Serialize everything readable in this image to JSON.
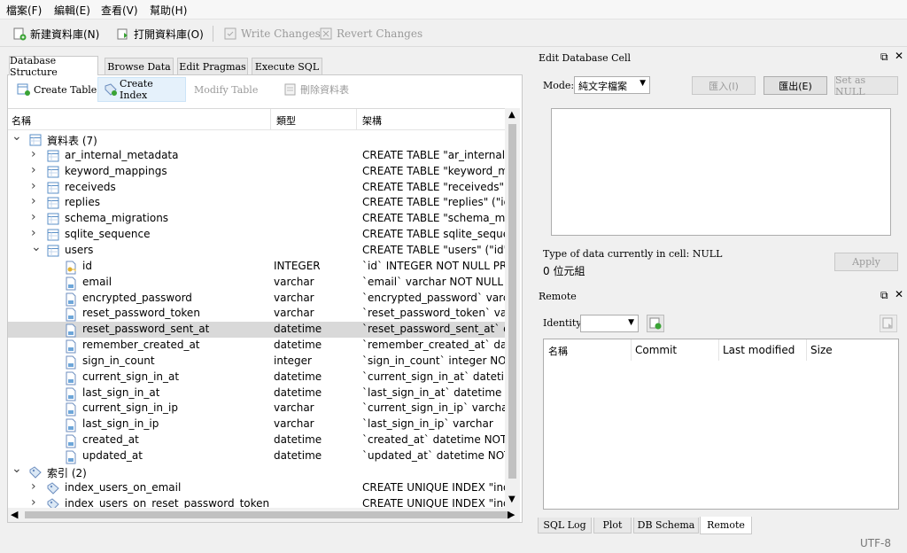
{
  "menu": [
    "檔案(F)",
    "編輯(E)",
    "查看(V)",
    "幫助(H)"
  ],
  "toolbar": {
    "new_db": "新建資料庫(N)",
    "open_db": "打開資料庫(O)",
    "write_changes": "Write Changes",
    "revert_changes": "Revert Changes"
  },
  "tabs": [
    "Database Structure",
    "Browse Data",
    "Edit Pragmas",
    "Execute SQL"
  ],
  "structure_toolbar": {
    "create_table": "Create Table",
    "create_index": "Create Index",
    "modify_table": "Modify Table",
    "delete": "刪除資料表"
  },
  "tree": {
    "headers": {
      "name": "名稱",
      "type": "類型",
      "schema": "架構"
    },
    "tables_group": "資料表 (7)",
    "tables": [
      {
        "name": "ar_internal_metadata",
        "schema": "CREATE TABLE \"ar_internal_m"
      },
      {
        "name": "keyword_mappings",
        "schema": "CREATE TABLE \"keyword_ma"
      },
      {
        "name": "receiveds",
        "schema": "CREATE TABLE \"receiveds\" (\"i"
      },
      {
        "name": "replies",
        "schema": "CREATE TABLE \"replies\" (\"id\""
      },
      {
        "name": "schema_migrations",
        "schema": "CREATE TABLE \"schema_migr"
      },
      {
        "name": "sqlite_sequence",
        "schema": "CREATE TABLE sqlite_sequen"
      },
      {
        "name": "users",
        "schema": "CREATE TABLE \"users\" (\"id\" IN"
      }
    ],
    "columns": [
      {
        "name": "id",
        "type": "INTEGER",
        "schema": "`id` INTEGER NOT NULL PRIM"
      },
      {
        "name": "email",
        "type": "varchar",
        "schema": "`email` varchar NOT NULL DE"
      },
      {
        "name": "encrypted_password",
        "type": "varchar",
        "schema": "`encrypted_password` varcha"
      },
      {
        "name": "reset_password_token",
        "type": "varchar",
        "schema": "`reset_password_token` varch"
      },
      {
        "name": "reset_password_sent_at",
        "type": "datetime",
        "schema": "`reset_password_sent_at` date"
      },
      {
        "name": "remember_created_at",
        "type": "datetime",
        "schema": "`remember_created_at` datet"
      },
      {
        "name": "sign_in_count",
        "type": "integer",
        "schema": "`sign_in_count` integer NOT N"
      },
      {
        "name": "current_sign_in_at",
        "type": "datetime",
        "schema": "`current_sign_in_at` datetime"
      },
      {
        "name": "last_sign_in_at",
        "type": "datetime",
        "schema": "`last_sign_in_at` datetime"
      },
      {
        "name": "current_sign_in_ip",
        "type": "varchar",
        "schema": "`current_sign_in_ip` varchar"
      },
      {
        "name": "last_sign_in_ip",
        "type": "varchar",
        "schema": "`last_sign_in_ip` varchar"
      },
      {
        "name": "created_at",
        "type": "datetime",
        "schema": "`created_at` datetime NOT N"
      },
      {
        "name": "updated_at",
        "type": "datetime",
        "schema": "`updated_at` datetime NOT N"
      }
    ],
    "indexes_group": "索引 (2)",
    "indexes": [
      {
        "name": "index_users_on_email",
        "schema": "CREATE UNIQUE INDEX \"ind"
      },
      {
        "name": "index_users_on_reset_password_token",
        "schema": "CREATE UNIQUE INDEX \"ind"
      }
    ]
  },
  "edit_cell": {
    "title": "Edit Database Cell",
    "mode_label": "Mode:",
    "mode_value": "純文字檔案",
    "import": "匯入(I)",
    "export": "匯出(E)",
    "set_null": "Set as NULL",
    "type_info": "Type of data currently in cell: NULL",
    "size_info": "0 位元組",
    "apply": "Apply"
  },
  "remote": {
    "title": "Remote",
    "identity_label": "Identity",
    "headers": [
      "名稱",
      "Commit",
      "Last modified",
      "Size"
    ]
  },
  "bottom_tabs": [
    "SQL Log",
    "Plot",
    "DB Schema",
    "Remote"
  ],
  "status": {
    "encoding": "UTF-8"
  },
  "colors": {
    "selection": "#d9d9d9",
    "hover": "#e5f1fb",
    "table_icon": "#5b8fc7",
    "field_icon": "#6c8ebf"
  }
}
